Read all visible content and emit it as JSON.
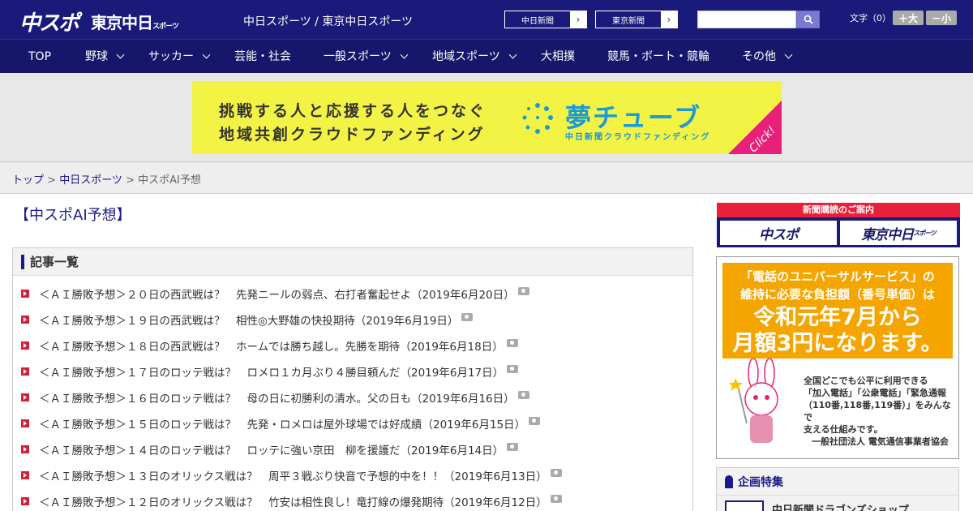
{
  "header": {
    "logo_main": "中スポ",
    "logo_tokyo": "東京中日",
    "logo_tokyo_small": "スポーツ",
    "site_links": "中日スポーツ / 東京中日スポーツ",
    "btn_chunichi": "中日新聞",
    "btn_tokyo": "東京新聞",
    "search_placeholder": "",
    "fontsize_label": "文字（0）",
    "fs_larger": "＋大",
    "fs_smaller": "－小"
  },
  "nav": {
    "items": [
      {
        "label": "TOP"
      },
      {
        "label": "野球"
      },
      {
        "label": "サッカー"
      },
      {
        "label": "芸能・社会"
      },
      {
        "label": "一般スポーツ"
      },
      {
        "label": "地域スポーツ"
      },
      {
        "label": "大相撲"
      },
      {
        "label": "競馬・ボート・競輪"
      },
      {
        "label": "その他"
      }
    ]
  },
  "banner": {
    "line1": "挑戦する人と応援する人をつなぐ",
    "line2": "地域共創クラウドファンディング",
    "brand": "夢チューブ",
    "brand_sub": "中日新聞クラウドファンディング",
    "click": "Click!"
  },
  "breadcrumb": {
    "top": "トップ",
    "section": "中日スポーツ",
    "current": "中スポAI予想",
    "sep": " > "
  },
  "main": {
    "title": "【中スポAI予想】",
    "list_heading": "記事一覧",
    "articles": [
      "＜ＡＩ勝敗予想＞２０日の西武戦は？　先発ニールの弱点、右打者奮起せよ（2019年6月20日）",
      "＜ＡＩ勝敗予想＞１９日の西武戦は？　相性◎大野雄の快投期待（2019年6月19日）",
      "＜ＡＩ勝敗予想＞１８日の西武戦は？　ホームでは勝ち越し。先勝を期待（2019年6月18日）",
      "＜ＡＩ勝敗予想＞１７日のロッテ戦は？　ロメロ１カ月ぶり４勝目頼んだ（2019年6月17日）",
      "＜ＡＩ勝敗予想＞１６日のロッテ戦は？　母の日に初勝利の清水。父の日も（2019年6月16日）",
      "＜ＡＩ勝敗予想＞１５日のロッテ戦は？　先発・ロメロは屋外球場では好成績（2019年6月15日）",
      "＜ＡＩ勝敗予想＞１４日のロッテ戦は？　ロッテに強い京田　柳を援護だ（2019年6月14日）",
      "＜ＡＩ勝敗予想＞１３日のオリックス戦は？　周平３戦ぶり快音で予想的中を！！（2019年6月13日）",
      "＜ＡＩ勝敗予想＞１２日のオリックス戦は？　竹安は相性良し！竜打線の爆発期待（2019年6月12日）"
    ]
  },
  "sidebar": {
    "subscribe_head": "新聞購読のご案内",
    "sub_chuspo": "中スポ",
    "sub_tokyo": "東京中日",
    "sub_tokyo_small": "スポーツ",
    "ad_line1": "「電話のユニバーサルサービス」の",
    "ad_line2": "維持に必要な負担額（番号単価）は",
    "ad_big1": "令和元年7月から",
    "ad_big2": "月額3円になります。",
    "ad_small1": "全国どこでも公平に利用できる",
    "ad_small2": "「加入電話」「公衆電話」「緊急通報",
    "ad_small3": "（110番,118番,119番）」をみんなで",
    "ad_small4": "支える仕組みです。",
    "ad_org": "一般社団法人 電気通信事業者協会",
    "feature_head": "企画特集",
    "feature_item": "中日新聞ドラゴンズショップ"
  },
  "colors": {
    "header_bg": "#1a1a7a",
    "accent_red": "#d0203a",
    "banner_yellow": "#f3f346",
    "ad_orange": "#f5a500"
  }
}
